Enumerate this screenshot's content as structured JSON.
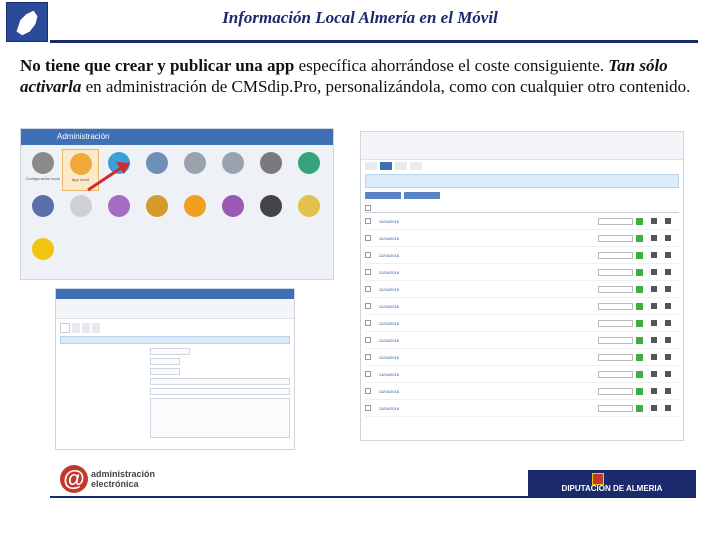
{
  "slide": {
    "title": "Información Local Almería en el Móvil",
    "body_bold": "No tiene que crear y publicar una app",
    "body_plain1": " específica ahorrándose el coste consiguiente. ",
    "body_bolditalic": "Tan sólo activarla",
    "body_plain2": " en administración de CMSdip.Pro, personalizándola, como con cualquier otro contenido."
  },
  "shots": {
    "admin_bar_label": "Administración",
    "icon_tiles": [
      {
        "label": "Configuración local",
        "color": "#8a8a8a"
      },
      {
        "label": "App móvil",
        "color": "#f2a93b"
      },
      {
        "label": "",
        "color": "#3aa0d8"
      },
      {
        "label": "",
        "color": "#6d8fb8"
      },
      {
        "label": "",
        "color": "#9aa3ad"
      },
      {
        "label": "",
        "color": "#9aa3ad"
      },
      {
        "label": "",
        "color": "#7a7a7a"
      },
      {
        "label": "",
        "color": "#37a37a"
      },
      {
        "label": "",
        "color": "#5b6fa8"
      },
      {
        "label": "",
        "color": "#d0d0d0"
      },
      {
        "label": "",
        "color": "#a56cc1"
      },
      {
        "label": "",
        "color": "#d49a2b"
      },
      {
        "label": "",
        "color": "#f0a020"
      },
      {
        "label": "",
        "color": "#9b59b6"
      },
      {
        "label": "",
        "color": "#444444"
      },
      {
        "label": "",
        "color": "#e2c24a"
      },
      {
        "label": "",
        "color": "#f1c40f"
      }
    ],
    "table_dates": [
      "10/04/2016",
      "12/04/2016",
      "12/04/2016",
      "12/04/2016",
      "12/04/2016",
      "12/04/2016",
      "12/04/2016",
      "12/04/2016",
      "12/04/2016",
      "13/04/2016",
      "13/04/2016",
      "13/04/2016"
    ]
  },
  "footer": {
    "logo_line1": "administración",
    "logo_line2": "electrónica",
    "institution": "DIPUTACION DE ALMERIA"
  }
}
